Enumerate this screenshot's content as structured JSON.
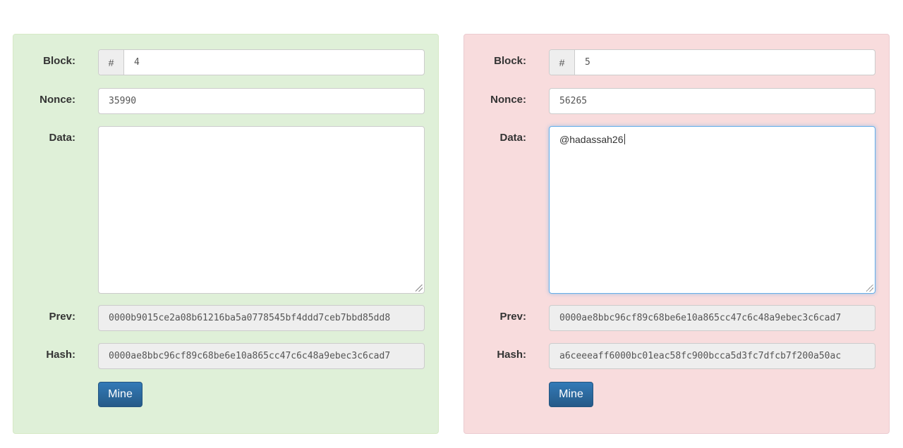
{
  "labels": {
    "block": "Block:",
    "nonce": "Nonce:",
    "data": "Data:",
    "prev": "Prev:",
    "hash": "Hash:",
    "hash_prefix": "#"
  },
  "blocks": [
    {
      "status": "valid",
      "number": "4",
      "nonce": "35990",
      "data": "",
      "prev": "0000b9015ce2a08b61216ba5a0778545bf4ddd7ceb7bbd85dd8",
      "hash": "0000ae8bbc96cf89c68be6e10a865cc47c6c48a9ebec3c6cad7",
      "mine_label": "Mine"
    },
    {
      "status": "invalid",
      "number": "5",
      "nonce": "56265",
      "data": "@hadassah26",
      "prev": "0000ae8bbc96cf89c68be6e10a865cc47c6c48a9ebec3c6cad7",
      "hash": "a6ceeeaff6000bc01eac58fc900bcca5d3fc7dfcb7f200a50ac",
      "mine_label": "Mine"
    }
  ],
  "colors": {
    "valid_bg": "#dff0d8",
    "invalid_bg": "#f8dcdd",
    "button": "#337ab7"
  }
}
